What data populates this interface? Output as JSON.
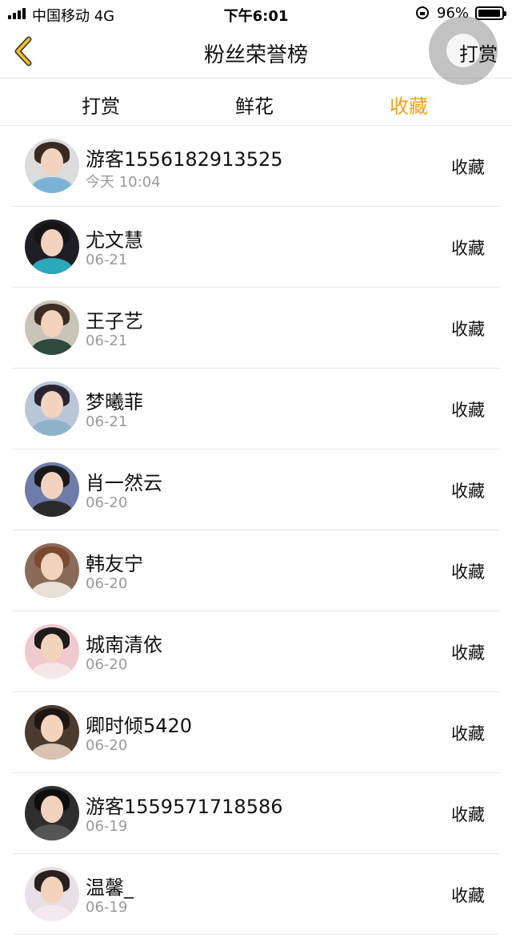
{
  "status_bar": {
    "carrier": "中国移动  4G",
    "time": "下午6:01",
    "battery_percent": "96%",
    "battery_level": 0.96
  },
  "navbar": {
    "title": "粉丝荣誉榜",
    "right_label": "打赏",
    "accent_color": "#f0a11c"
  },
  "tabs": [
    {
      "label": "打赏",
      "active": false
    },
    {
      "label": "鲜花",
      "active": false
    },
    {
      "label": "收藏",
      "active": true
    }
  ],
  "fans": [
    {
      "name": "游客1556182913525",
      "date": "今天 10:04",
      "action": "收藏",
      "avatar": {
        "bg": "#dcdcdc",
        "hair": "#3a2a22",
        "body": "#7bb3d6"
      }
    },
    {
      "name": "尤文慧",
      "date": "06-21",
      "action": "收藏",
      "avatar": {
        "bg": "#1e1e24",
        "hair": "#151515",
        "body": "#2aa9b8"
      }
    },
    {
      "name": "王子艺",
      "date": "06-21",
      "action": "收藏",
      "avatar": {
        "bg": "#c9c3b8",
        "hair": "#3b2c24",
        "body": "#2f4a3c"
      }
    },
    {
      "name": "梦曦菲",
      "date": "06-21",
      "action": "收藏",
      "avatar": {
        "bg": "#b9c6d8",
        "hair": "#2b2430",
        "body": "#8fb4c9"
      }
    },
    {
      "name": "肖一然云",
      "date": "06-20",
      "action": "收藏",
      "avatar": {
        "bg": "#6d7ca8",
        "hair": "#1a1a1a",
        "body": "#2a2a2a"
      }
    },
    {
      "name": "韩友宁",
      "date": "06-20",
      "action": "收藏",
      "avatar": {
        "bg": "#8a6b5a",
        "hair": "#7a4a2f",
        "body": "#e9e0d6"
      }
    },
    {
      "name": "城南清依",
      "date": "06-20",
      "action": "收藏",
      "avatar": {
        "bg": "#f0c9cf",
        "hair": "#1c1c1c",
        "body": "#f5e6e8"
      }
    },
    {
      "name": "卿时倾5420",
      "date": "06-20",
      "action": "收藏",
      "avatar": {
        "bg": "#4a3a30",
        "hair": "#1e1612",
        "body": "#d9c3b0"
      }
    },
    {
      "name": "游客1559571718586",
      "date": "06-19",
      "action": "收藏",
      "avatar": {
        "bg": "#2e2e2e",
        "hair": "#0f0f0f",
        "body": "#555555"
      }
    },
    {
      "name": "温馨_",
      "date": "06-19",
      "action": "收藏",
      "avatar": {
        "bg": "#e9dfe6",
        "hair": "#2a2020",
        "body": "#f3eaf0"
      }
    }
  ],
  "icons": {
    "back": "chevron-left-icon",
    "assistive": "assistive-touch-icon",
    "lock": "orientation-lock-icon",
    "battery": "battery-icon",
    "signal": "signal-icon"
  }
}
